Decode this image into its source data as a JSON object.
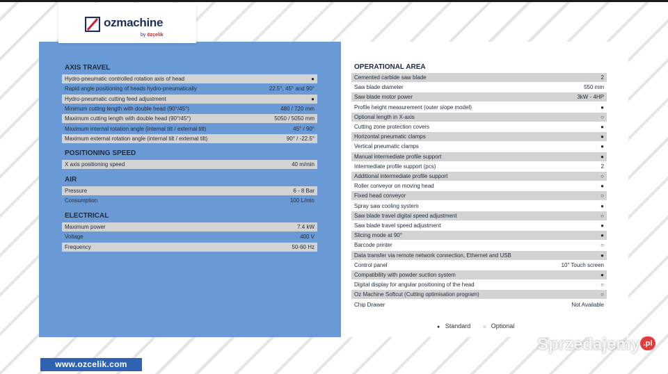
{
  "brand": {
    "name": "ozmachine",
    "by_label": "by",
    "by_brand": "özçelik"
  },
  "left": {
    "sections": [
      {
        "title": "AXIS TRAVEL",
        "rows": [
          {
            "label": "Hydro-pneumatic controlled rotation axis of head",
            "value": "●"
          },
          {
            "label": "Rapid angle positioning of heads hydro-pneumatically",
            "value": "22.5°, 45° and 90°"
          },
          {
            "label": "Hydro-pneumatic cutting feed adjustment",
            "value": "●"
          },
          {
            "label": "Minimum cutting length with double head  (90°/45°)",
            "value": "480 / 720 mm"
          },
          {
            "label": "Maximum cutting length with double head  (90°/45°)",
            "value": "5050 / 5050 mm"
          },
          {
            "label": "Maximum internal rotation angle (internal tilt / external tilt)",
            "value": "45° / 90°"
          },
          {
            "label": "Maximum external rotation angle (internal tilt / external tilt)",
            "value": "90° / -22.5°"
          }
        ]
      },
      {
        "title": "POSITIONING SPEED",
        "rows": [
          {
            "label": "X axis positioning speed",
            "value": "40 m/min"
          }
        ]
      },
      {
        "title": "AIR",
        "rows": [
          {
            "label": "Pressure",
            "value": "6 - 8 Bar"
          },
          {
            "label": "Consumption",
            "value": "100 L/min"
          }
        ]
      },
      {
        "title": "ELECTRICAL",
        "rows": [
          {
            "label": "Maximum power",
            "value": "7.4 kW"
          },
          {
            "label": "Voltage",
            "value": "400 V"
          },
          {
            "label": "Frequency",
            "value": "50-60 Hz"
          }
        ]
      }
    ]
  },
  "right": {
    "title": "OPERATIONAL AREA",
    "rows": [
      {
        "label": "Cemented carbide saw blade",
        "value": "2"
      },
      {
        "label": "Saw blade diameter",
        "value": "550 mm"
      },
      {
        "label": "Saw blade motor power",
        "value": "3kW - 4HP"
      },
      {
        "label": "Profile height measurement (outer slope model)",
        "value": "●"
      },
      {
        "label": "Optional length in X-axis",
        "value": "○"
      },
      {
        "label": "Cutting zone protection covers",
        "value": "●"
      },
      {
        "label": "Horizontal pneumatic clamps",
        "value": "●"
      },
      {
        "label": "Vertical pneumatic clamps",
        "value": "●"
      },
      {
        "label": "Manual intermediate profile support",
        "value": "●"
      },
      {
        "label": "Intermediate profile support (pcs)",
        "value": "2"
      },
      {
        "label": "Additional intermediate profile support",
        "value": "○"
      },
      {
        "label": "Roller conveyor on moving head",
        "value": "●"
      },
      {
        "label": "Fixed head conveyor",
        "value": "○"
      },
      {
        "label": "Spray saw cooling system",
        "value": "●"
      },
      {
        "label": "Saw blade travel digital speed adjustment",
        "value": "○"
      },
      {
        "label": "Saw blade travel speed adjustment",
        "value": "●"
      },
      {
        "label": "Slicing mode at 90°",
        "value": "●"
      },
      {
        "label": "Barcode printer",
        "value": "○"
      },
      {
        "label": "Data transfer via remote network connection, Ethernet and USB",
        "value": "●"
      },
      {
        "label": "Control panel",
        "value": "10\" Touch screen"
      },
      {
        "label": "Compatibility with powder suction system",
        "value": "●"
      },
      {
        "label": "Digital display for angular positioning of the head",
        "value": "○"
      },
      {
        "label": "Oz Machine Softcut (Cutting optimisation program)",
        "value": "○"
      },
      {
        "label": "Chip Drawer",
        "value": "Not Available"
      }
    ],
    "legend": {
      "standard_symbol": "●",
      "standard_label": "Standard",
      "optional_symbol": "○",
      "optional_label": "Optional"
    }
  },
  "footer": {
    "url": "www.ozcelik.com"
  },
  "watermark": {
    "text": "Sprzedajemy",
    "badge": ".pl"
  },
  "colors": {
    "left_panel": "#6a9ad6",
    "row_shade": "#d3d3d3",
    "brand_navy": "#1c2f5c",
    "brand_red": "#c8202f",
    "footer_blue": "#2f62b3"
  }
}
